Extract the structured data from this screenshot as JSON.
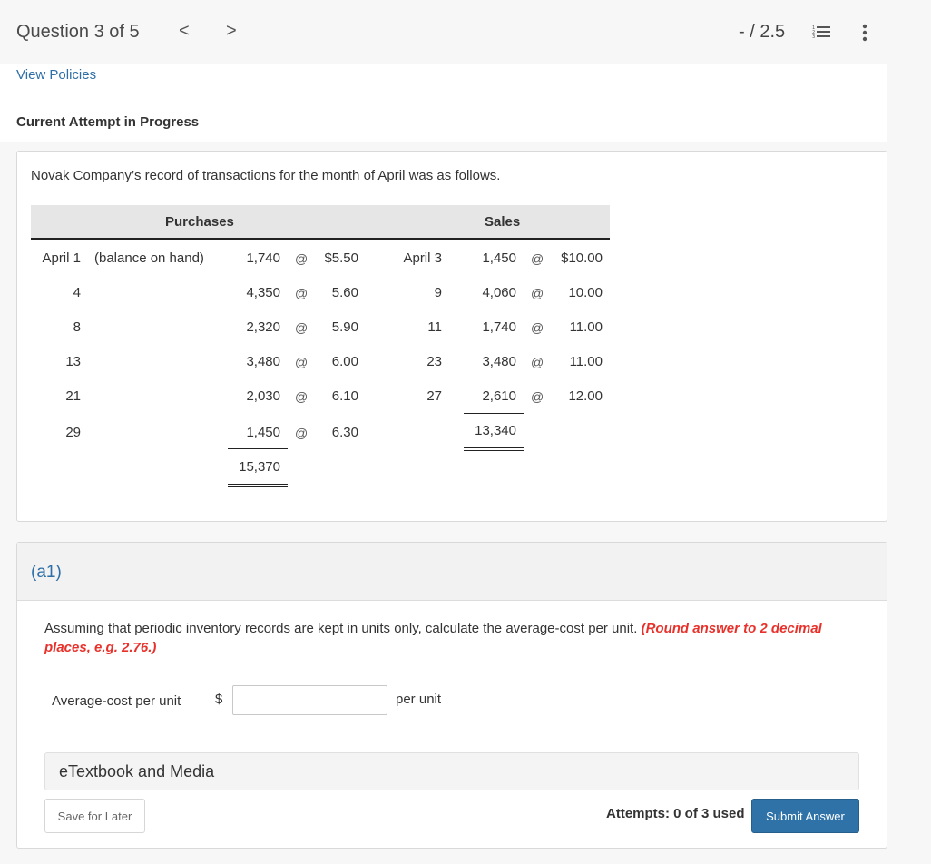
{
  "header": {
    "question_title": "Question 3 of 5",
    "prev_icon": "chevron-left-icon",
    "next_icon": "chevron-right-icon",
    "score": "- / 2.5",
    "list_icon": "numbered-list-icon",
    "more_icon": "more-vertical-icon",
    "prev_glyph": "<",
    "next_glyph": ">"
  },
  "links": {
    "view_policies": "View Policies"
  },
  "status": {
    "attempt_label": "Current Attempt in Progress"
  },
  "problem": {
    "intro": "Novak Company’s record of transactions for the month of April was as follows.",
    "purchases_header": "Purchases",
    "sales_header": "Sales",
    "at_symbol": "@",
    "purchases": [
      {
        "date": "April 1",
        "note": "(balance on hand)",
        "units": "1,740",
        "price": "$5.50"
      },
      {
        "date": "4",
        "note": "",
        "units": "4,350",
        "price": "5.60"
      },
      {
        "date": "8",
        "note": "",
        "units": "2,320",
        "price": "5.90"
      },
      {
        "date": "13",
        "note": "",
        "units": "3,480",
        "price": "6.00"
      },
      {
        "date": "21",
        "note": "",
        "units": "2,030",
        "price": "6.10"
      },
      {
        "date": "29",
        "note": "",
        "units": "1,450",
        "price": "6.30"
      }
    ],
    "purchases_total": "15,370",
    "sales": [
      {
        "date": "April 3",
        "units": "1,450",
        "price": "$10.00"
      },
      {
        "date": "9",
        "units": "4,060",
        "price": "10.00"
      },
      {
        "date": "11",
        "units": "1,740",
        "price": "11.00"
      },
      {
        "date": "23",
        "units": "3,480",
        "price": "11.00"
      },
      {
        "date": "27",
        "units": "2,610",
        "price": "12.00"
      }
    ],
    "sales_total": "13,340"
  },
  "part": {
    "label": "(a1)",
    "instruction": "Assuming that periodic inventory records are kept in units only, calculate the average-cost per unit.",
    "hint": "(Round answer to 2 decimal places, e.g. 2.76.)",
    "field_label": "Average-cost per unit",
    "currency": "$",
    "answer_value": "",
    "unit_suffix": "per unit",
    "hint_color": "#e8312a"
  },
  "footer": {
    "etextbook": "eTextbook and Media",
    "save_label": "Save for Later",
    "attempts": "Attempts: 0 of 3 used",
    "submit_label": "Submit Answer",
    "accent_color": "#2e72a8"
  }
}
